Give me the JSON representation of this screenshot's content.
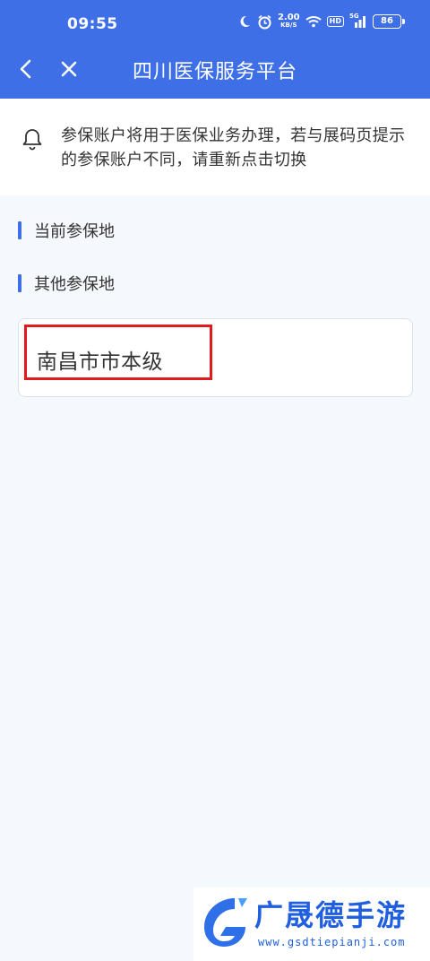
{
  "status_bar": {
    "time": "09:55",
    "net_speed": "2.00",
    "net_unit": "KB/S",
    "hd": "HD",
    "signal": "5G",
    "battery": "86"
  },
  "nav": {
    "title": "四川医保服务平台",
    "accent_color": "#3f6fe6"
  },
  "notice": {
    "icon": "bell-icon",
    "text": "参保账户将用于医保业务办理，若与展码页提示的参保账户不同，请重新点击切换"
  },
  "sections": {
    "current_label": "当前参保地",
    "other_label": "其他参保地"
  },
  "other_locations": [
    {
      "name": "南昌市市本级"
    }
  ],
  "watermark": {
    "title": "广晟德手游",
    "url": "www.gsdtiepianji.com"
  }
}
